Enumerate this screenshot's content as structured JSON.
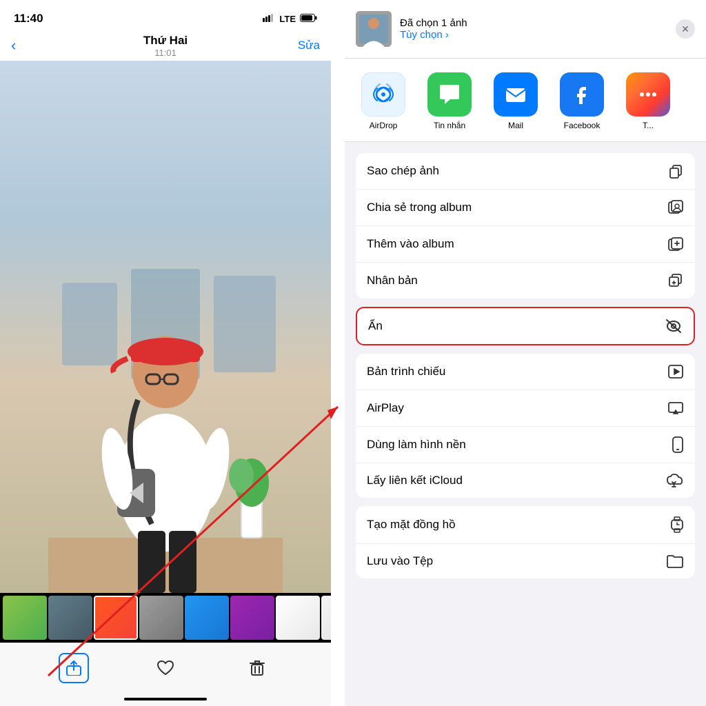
{
  "status": {
    "time": "11:40",
    "signal": "▌▌▌",
    "network": "LTE",
    "battery": "🔋"
  },
  "nav": {
    "back_icon": "‹",
    "title": "Thứ Hai",
    "subtitle": "11:01",
    "action": "Sửa"
  },
  "share_header": {
    "title": "Đã chọn 1 ảnh",
    "subtitle": "Tùy chọn ›",
    "close_icon": "✕"
  },
  "app_icons": [
    {
      "id": "airdrop",
      "label": "AirDrop"
    },
    {
      "id": "messages",
      "label": "Tin nhắn"
    },
    {
      "id": "mail",
      "label": "Mail"
    },
    {
      "id": "facebook",
      "label": "Facebook"
    },
    {
      "id": "more",
      "label": "T..."
    }
  ],
  "actions": [
    {
      "section": 1,
      "items": [
        {
          "label": "Sao chép ảnh",
          "icon": "copy"
        },
        {
          "label": "Chia sẻ trong album",
          "icon": "album-share"
        },
        {
          "label": "Thêm vào album",
          "icon": "album-add"
        },
        {
          "label": "Nhân bản",
          "icon": "duplicate"
        }
      ]
    },
    {
      "section": 2,
      "items": [
        {
          "label": "Ẩn",
          "icon": "eye-off",
          "highlighted": true
        }
      ]
    },
    {
      "section": 3,
      "items": [
        {
          "label": "Bản trình chiếu",
          "icon": "play"
        },
        {
          "label": "AirPlay",
          "icon": "airplay"
        },
        {
          "label": "Dùng làm hình nền",
          "icon": "phone"
        },
        {
          "label": "Lấy liên kết iCloud",
          "icon": "cloud-link"
        }
      ]
    },
    {
      "section": 4,
      "items": [
        {
          "label": "Tạo mặt đồng hồ",
          "icon": "watch"
        },
        {
          "label": "Lưu vào Tệp",
          "icon": "folder"
        }
      ]
    }
  ],
  "toolbar": {
    "share_icon": "share",
    "heart_icon": "♡",
    "trash_icon": "🗑"
  }
}
